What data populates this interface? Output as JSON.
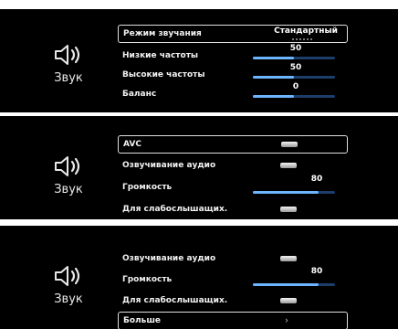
{
  "sound_label": "Звук",
  "icons": {
    "speaker": "speaker-volume-icon"
  },
  "colors": {
    "background": "#000000",
    "slider_fill": "#6db4ff",
    "slider_track": "#1d3d6b"
  },
  "panel1": {
    "rows": [
      {
        "label": "Режим звучания",
        "value": "Стандартный"
      },
      {
        "label": "Низкие частоты",
        "value": "50",
        "level": 0.5
      },
      {
        "label": "Высокие частоты",
        "value": "50",
        "level": 0.5
      },
      {
        "label": "Баланс",
        "value": "0",
        "level": 0.5
      }
    ]
  },
  "panel2": {
    "rows": [
      {
        "label": "AVC"
      },
      {
        "label": "Озвучивание аудио"
      },
      {
        "label": "Громкость",
        "value": "80",
        "level": 0.8
      },
      {
        "label": "Для слабослышащих."
      }
    ]
  },
  "panel3": {
    "rows": [
      {
        "label": "Озвучивание аудио"
      },
      {
        "label": "Громкость",
        "value": "80",
        "level": 0.8
      },
      {
        "label": "Для слабослышащих."
      },
      {
        "label": "Больше",
        "chevron": "›"
      }
    ]
  }
}
